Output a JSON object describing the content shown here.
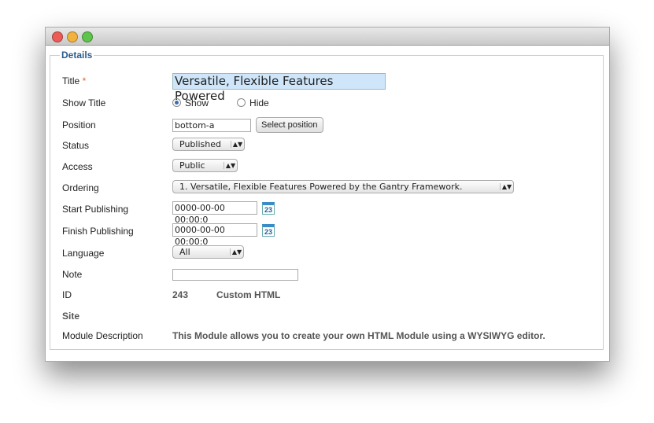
{
  "legend": "Details",
  "fields": {
    "title": {
      "label": "Title",
      "required": "*",
      "value": "Versatile, Flexible Features Powered"
    },
    "show_title": {
      "label": "Show Title",
      "show": "Show",
      "hide": "Hide"
    },
    "position": {
      "label": "Position",
      "value": "bottom-a",
      "button": "Select position"
    },
    "status": {
      "label": "Status",
      "value": "Published"
    },
    "access": {
      "label": "Access",
      "value": "Public"
    },
    "ordering": {
      "label": "Ordering",
      "value": "1. Versatile, Flexible Features Powered by the Gantry Framework."
    },
    "start": {
      "label": "Start Publishing",
      "value": "0000-00-00 00:00:0",
      "cal": "23"
    },
    "finish": {
      "label": "Finish Publishing",
      "value": "0000-00-00 00:00:0",
      "cal": "23"
    },
    "language": {
      "label": "Language",
      "value": "All"
    },
    "note": {
      "label": "Note",
      "value": ""
    },
    "id": {
      "label": "ID",
      "value": "243",
      "type": "Custom HTML"
    },
    "site": {
      "label": "Site"
    },
    "desc": {
      "label": "Module Description",
      "value": "This Module allows you to create your own HTML Module using a WYSIWYG editor."
    }
  }
}
